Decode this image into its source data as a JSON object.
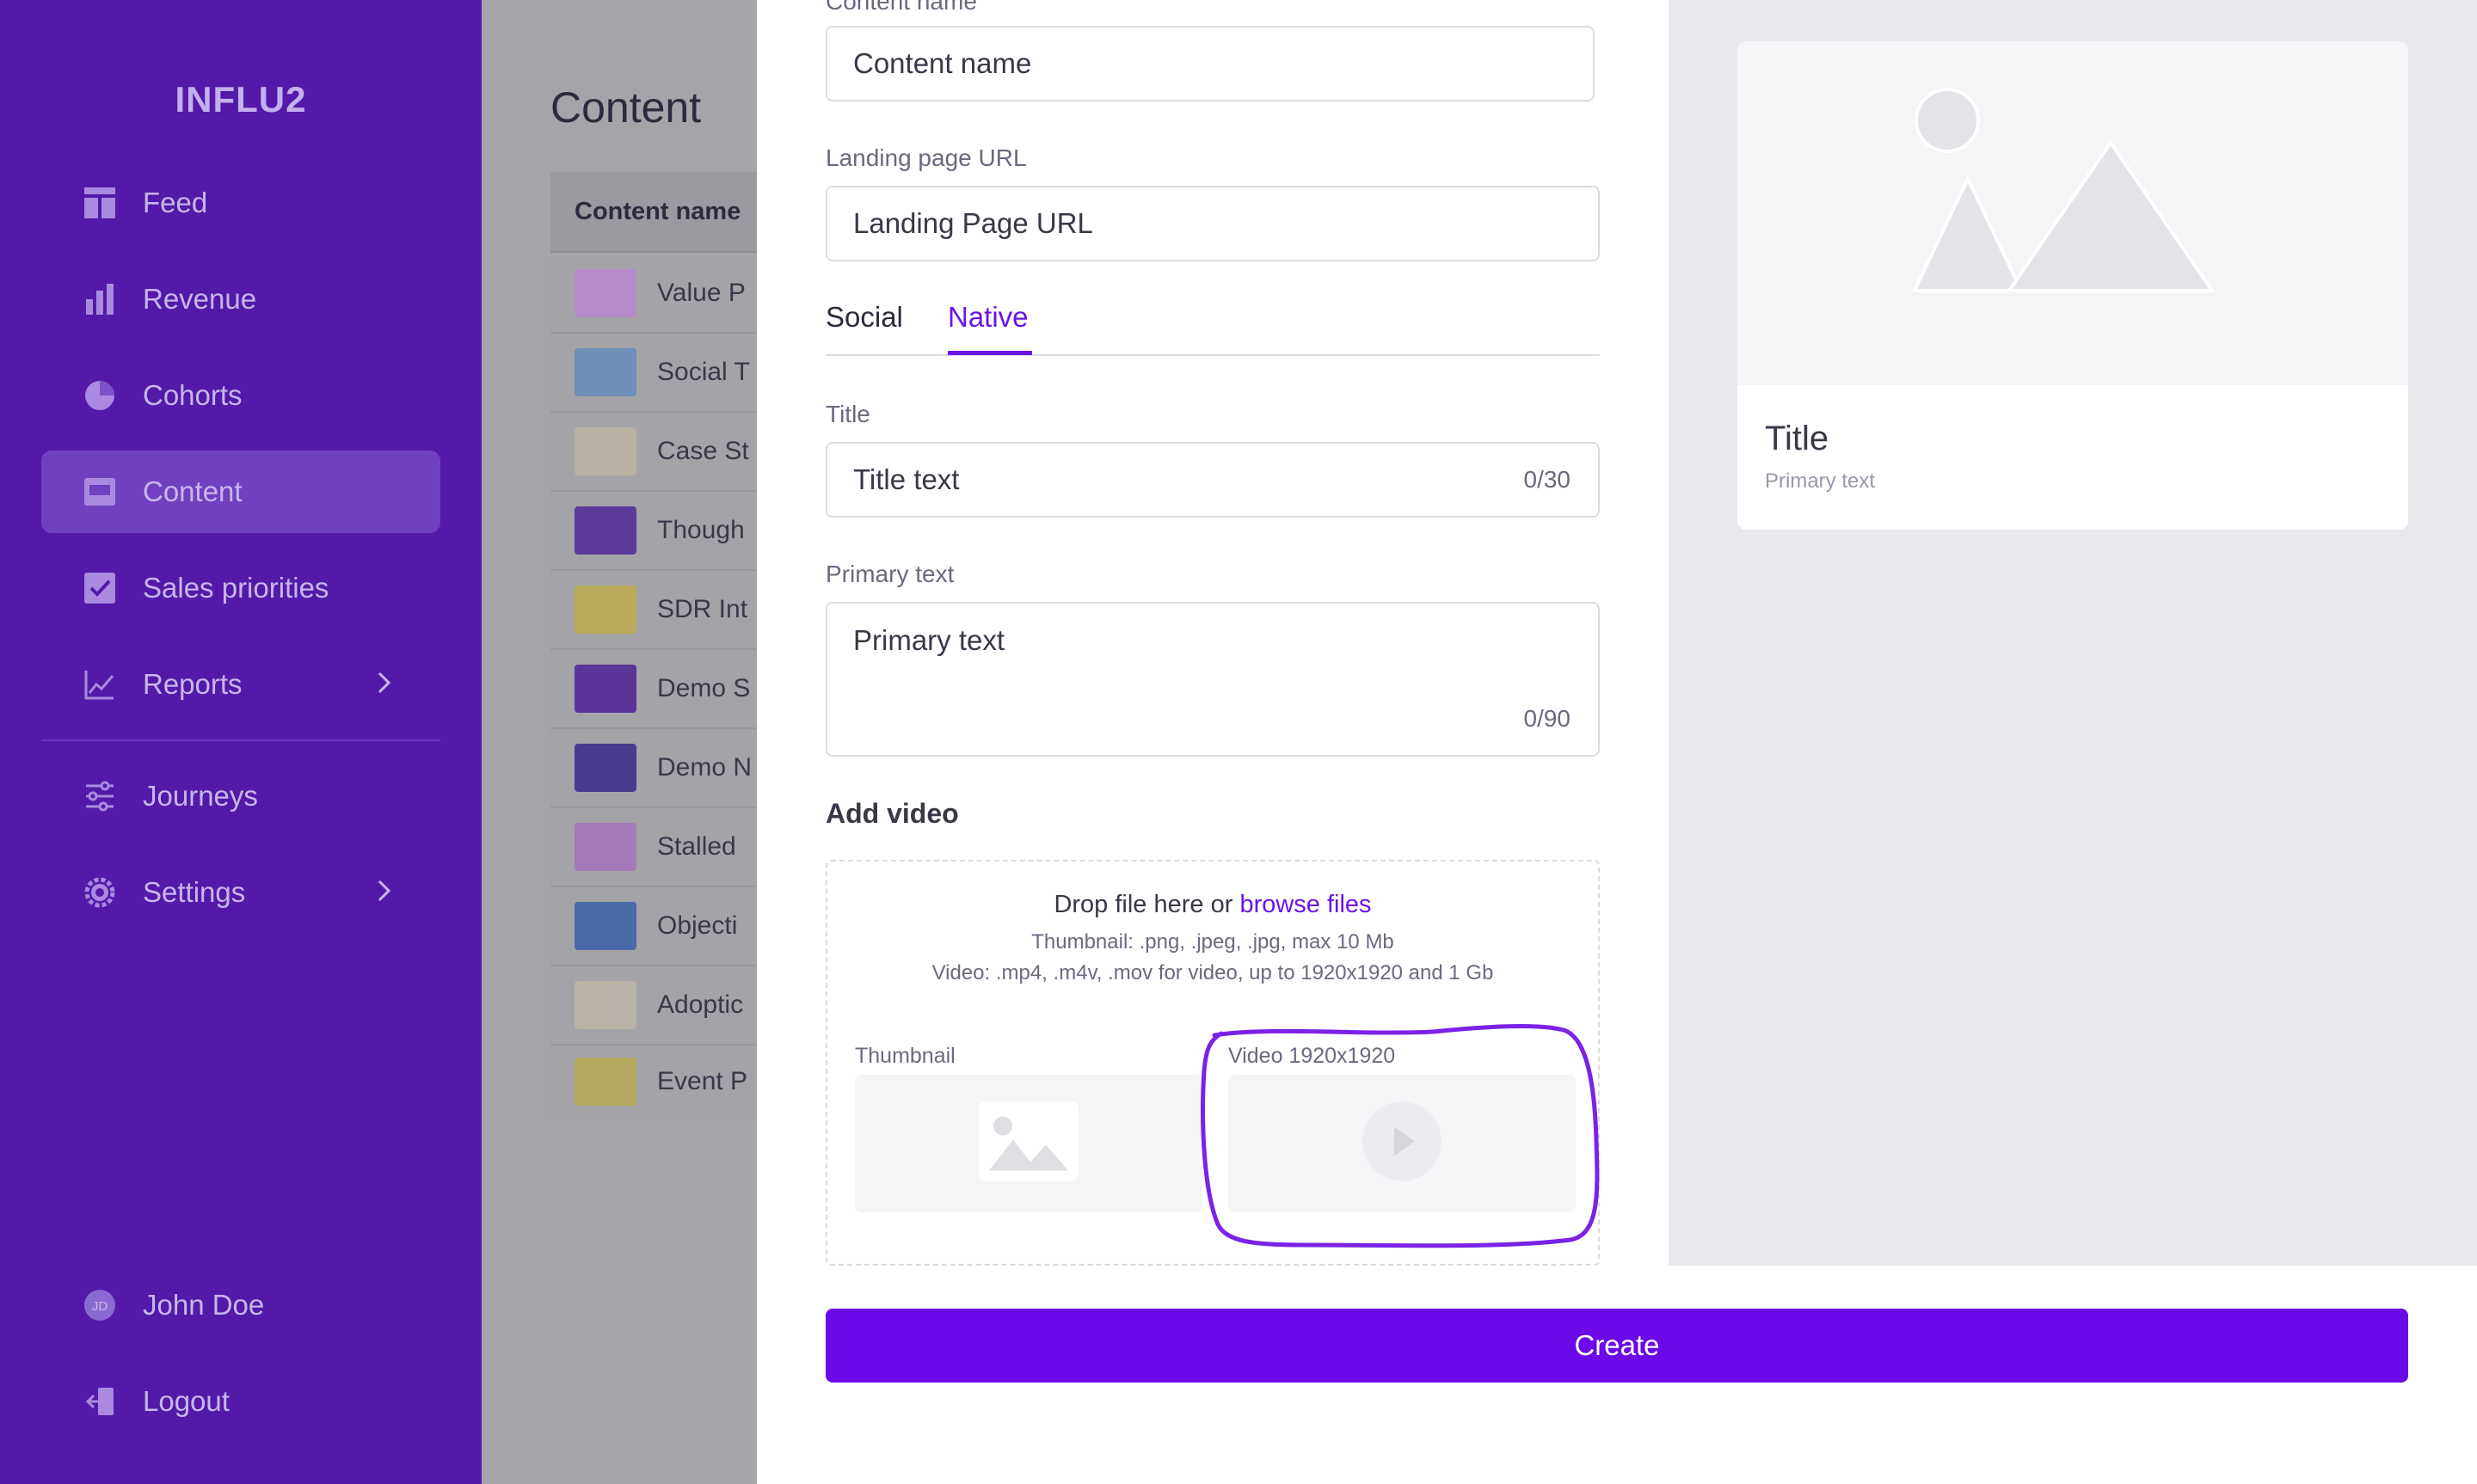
{
  "sidebar": {
    "logo": "INFLU2",
    "items": [
      {
        "label": "Feed",
        "icon": "feed-icon"
      },
      {
        "label": "Revenue",
        "icon": "bar-chart-icon"
      },
      {
        "label": "Cohorts",
        "icon": "pie-chart-icon"
      },
      {
        "label": "Content",
        "icon": "content-icon",
        "active": true
      },
      {
        "label": "Sales priorities",
        "icon": "checkbox-icon"
      },
      {
        "label": "Reports",
        "icon": "line-chart-icon"
      },
      {
        "label": "Journeys",
        "icon": "sliders-icon"
      },
      {
        "label": "Settings",
        "icon": "gear-icon"
      }
    ],
    "user": {
      "initials": "JD",
      "name": "John Doe"
    },
    "logout": "Logout"
  },
  "page": {
    "title": "Content",
    "column_header": "Content name",
    "rows": [
      "Value P",
      "Social T",
      "Case St",
      "Though",
      "SDR Int",
      "Demo S",
      "Demo N",
      "Stalled",
      "Objecti",
      "Adoptic",
      "Event P"
    ]
  },
  "form": {
    "content_name_label": "Content name",
    "content_name_value": "Content name",
    "landing_label": "Landing page URL",
    "landing_value": "Landing Page URL",
    "tabs": [
      "Social",
      "Native"
    ],
    "active_tab": "Native",
    "title_label": "Title",
    "title_value": "Title text",
    "title_counter": "0/30",
    "primary_label": "Primary text",
    "primary_value": "Primary text",
    "primary_counter": "0/90",
    "add_video": "Add video",
    "drop_text": "Drop file here or",
    "browse": "browse files",
    "thumb_hint": "Thumbnail: .png, .jpeg, .jpg, max 10 Mb",
    "video_hint": "Video: .mp4, .m4v, .mov for video, up to 1920x1920 and 1 Gb",
    "thumbnail_label": "Thumbnail",
    "video_label": "Video 1920x1920",
    "create": "Create"
  },
  "preview": {
    "title": "Title",
    "primary": "Primary text"
  },
  "colors": {
    "sidebar": "#5419a9",
    "accent": "#6b14e6",
    "button": "#6b0ae8",
    "annotation": "#7b22e6"
  }
}
